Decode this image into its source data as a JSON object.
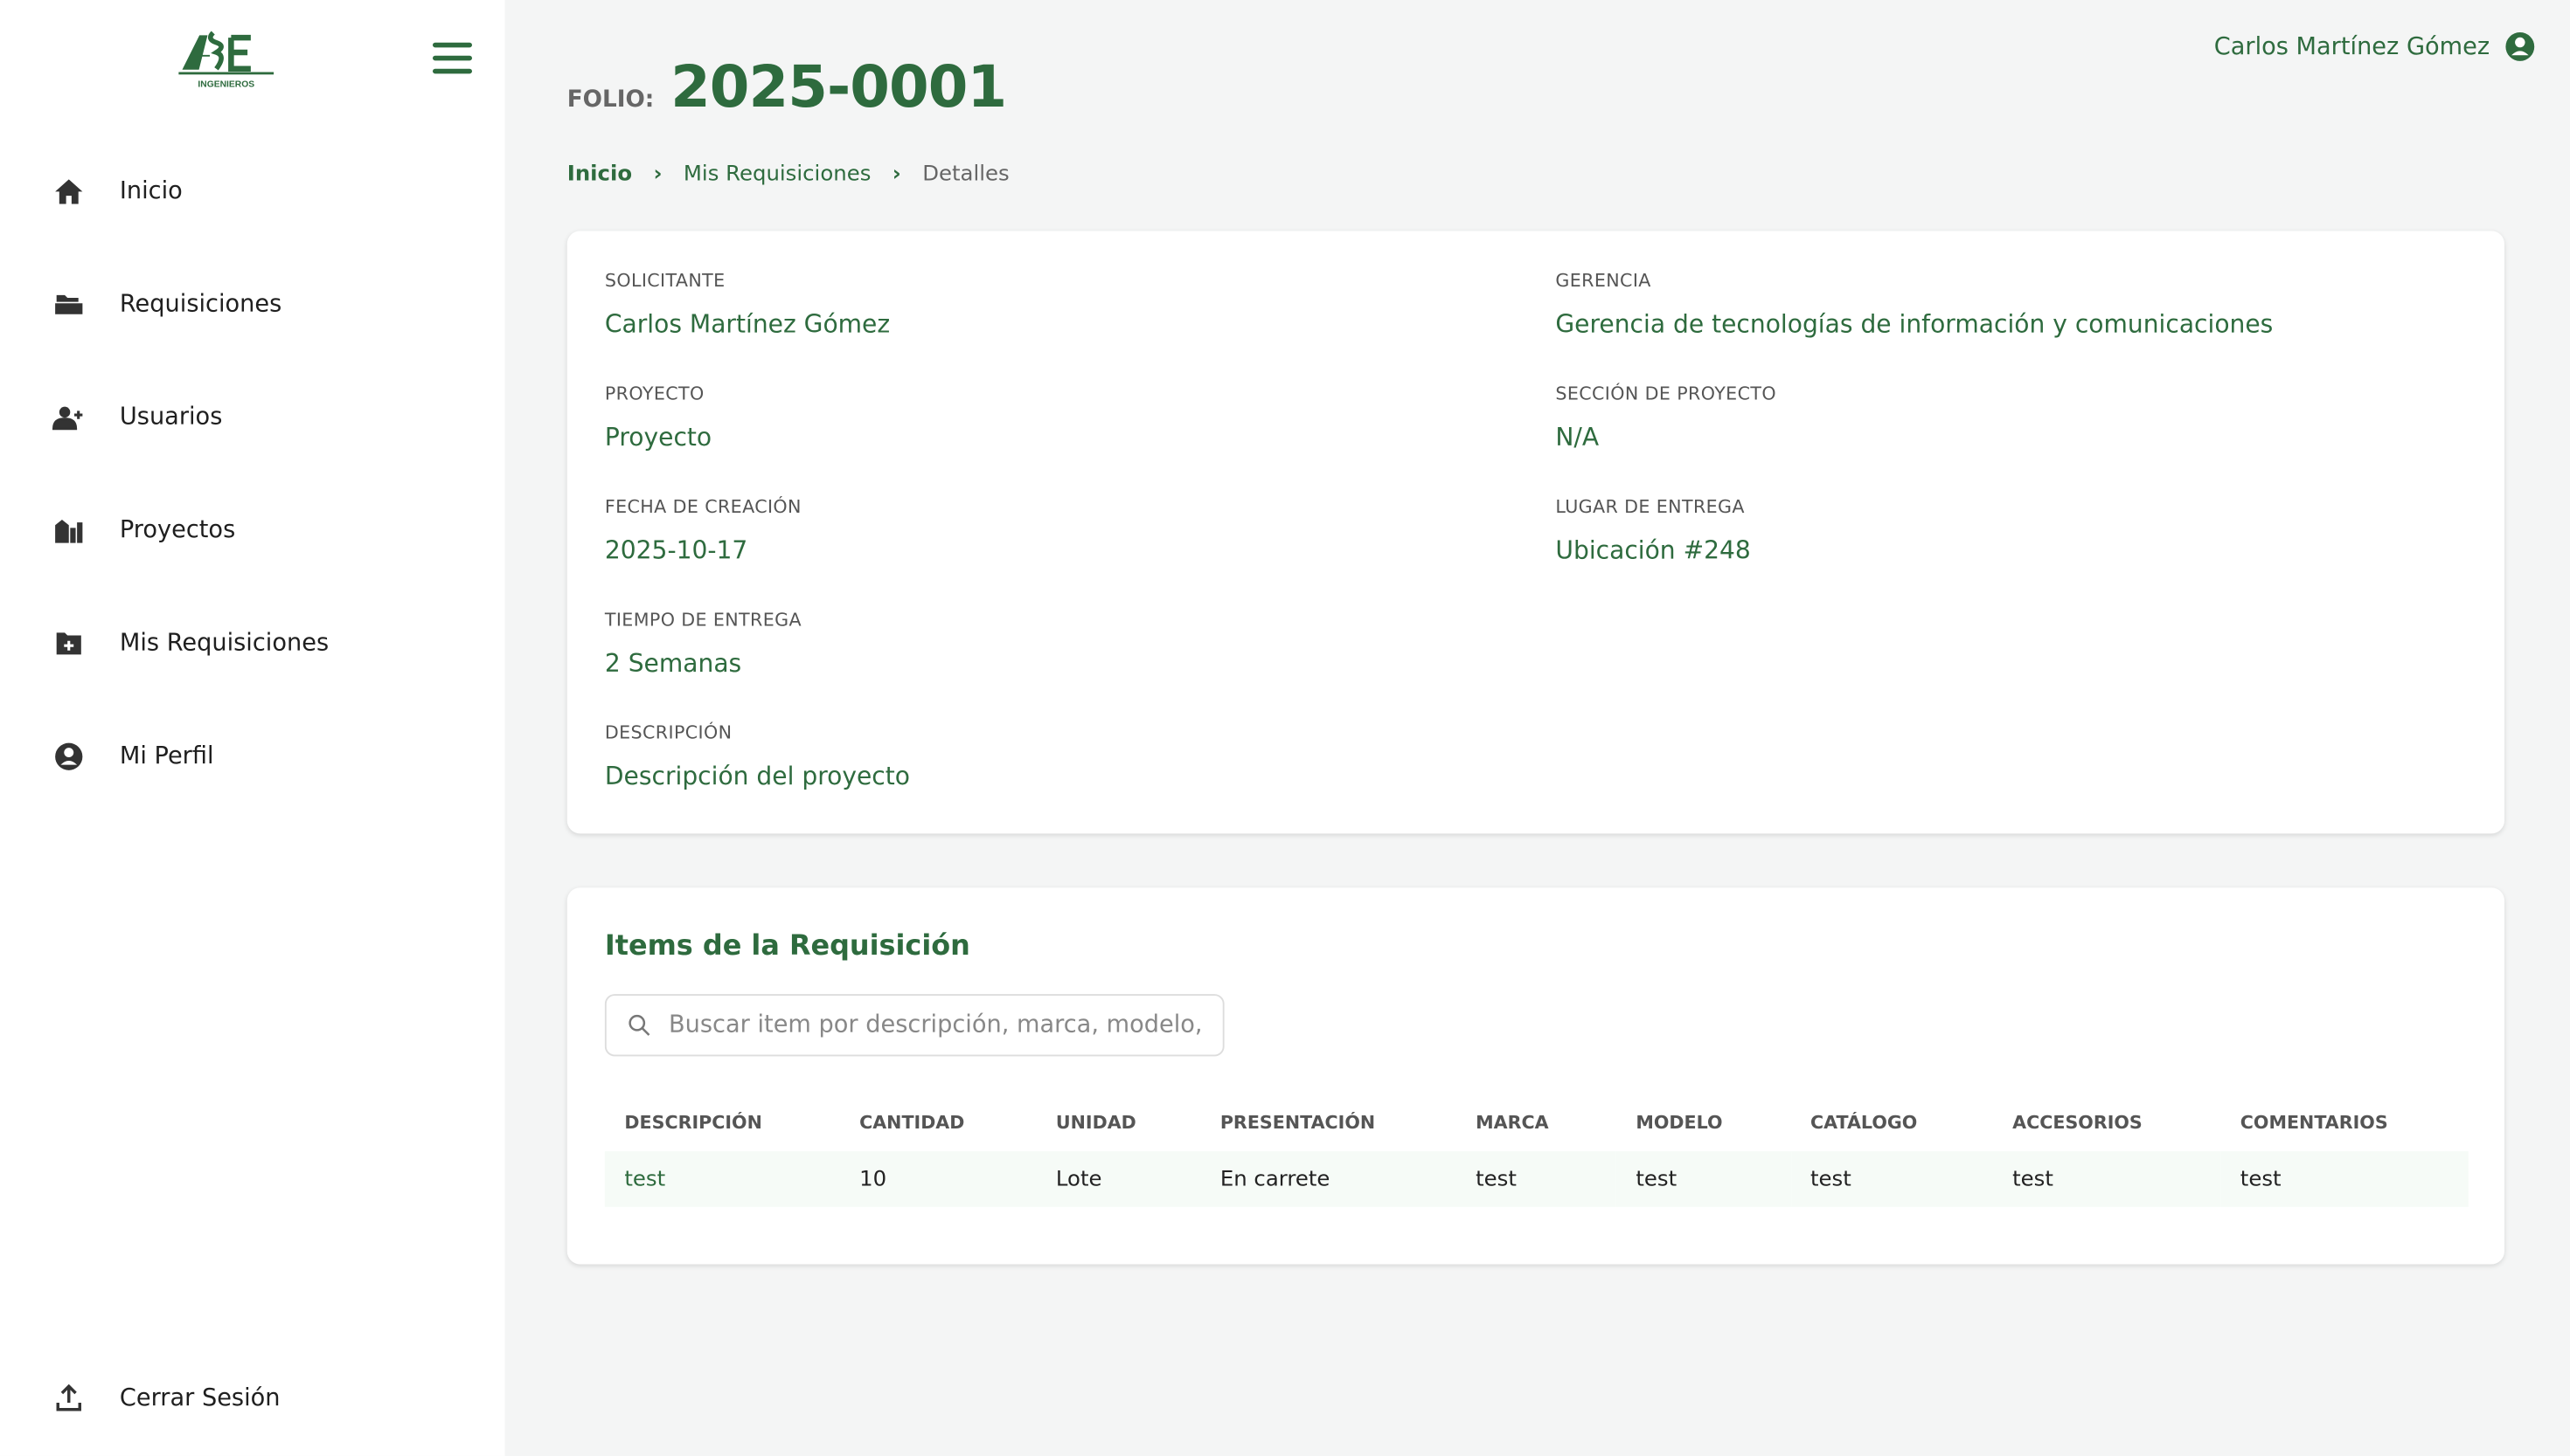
{
  "brand": {
    "logo_text": "ABE",
    "logo_subtext": "INGENIEROS",
    "accent": "#2e6b3e"
  },
  "sidebar": {
    "items": [
      {
        "label": "Inicio",
        "icon": "home-icon"
      },
      {
        "label": "Requisiciones",
        "icon": "folder-open-icon"
      },
      {
        "label": "Usuarios",
        "icon": "user-plus-icon"
      },
      {
        "label": "Proyectos",
        "icon": "city-icon"
      },
      {
        "label": "Mis Requisiciones",
        "icon": "folder-plus-icon"
      },
      {
        "label": "Mi Perfil",
        "icon": "user-circle-icon"
      }
    ],
    "logout": "Cerrar Sesión"
  },
  "header": {
    "user_name": "Carlos Martínez Gómez",
    "folio_label": "FOLIO:",
    "folio": "2025-0001"
  },
  "breadcrumb": [
    "Inicio",
    "Mis Requisiciones",
    "Detalles"
  ],
  "details": {
    "solicitante": {
      "label": "SOLICITANTE",
      "value": "Carlos Martínez Gómez"
    },
    "gerencia": {
      "label": "GERENCIA",
      "value": "Gerencia de tecnologías de información y comunicaciones"
    },
    "proyecto": {
      "label": "PROYECTO",
      "value": "Proyecto"
    },
    "seccion": {
      "label": "SECCIÓN DE PROYECTO",
      "value": "N/A"
    },
    "fecha": {
      "label": "FECHA DE CREACIÓN",
      "value": "2025-10-17"
    },
    "lugar": {
      "label": "LUGAR DE ENTREGA",
      "value": "Ubicación #248"
    },
    "tiempo": {
      "label": "TIEMPO DE ENTREGA",
      "value": "2 Semanas"
    },
    "descripcion": {
      "label": "DESCRIPCIÓN",
      "value": "Descripción del proyecto"
    }
  },
  "items": {
    "title": "Items de la Requisición",
    "search_placeholder": "Buscar item por descripción, marca, modelo, catálogo...",
    "columns": [
      "DESCRIPCIÓN",
      "CANTIDAD",
      "UNIDAD",
      "PRESENTACIÓN",
      "MARCA",
      "MODELO",
      "CATÁLOGO",
      "ACCESORIOS",
      "COMENTARIOS"
    ],
    "rows": [
      [
        "test",
        "10",
        "Lote",
        "En carrete",
        "test",
        "test",
        "test",
        "test",
        "test"
      ]
    ]
  }
}
